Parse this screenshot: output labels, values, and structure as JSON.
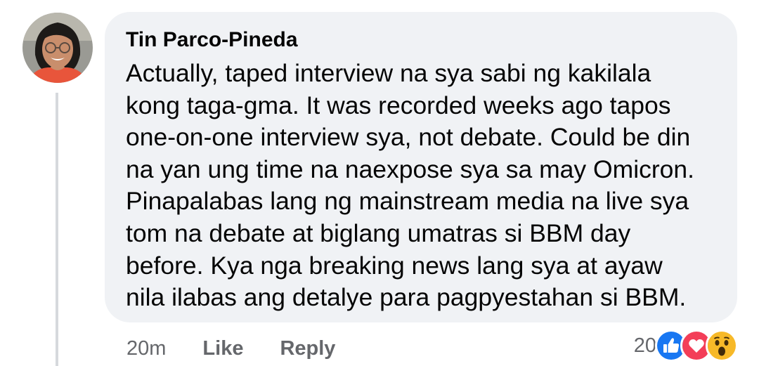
{
  "comment": {
    "author": "Tin Parco-Pineda",
    "text": "Actually, taped interview na sya sabi ng kakilala\nkong taga-gma. It was recorded weeks ago tapos\none-on-one interview sya, not debate. Could be din\nna yan ung time na naexpose sya sa may Omicron.\nPinapalabas lang ng mainstream media na live sya\ntom na debate at biglang umatras si BBM day\nbefore. Kya nga breaking news lang sya at ayaw\nnila ilabas ang detalye para pagpyestahan si BBM."
  },
  "actions": {
    "timestamp": "20m",
    "like_label": "Like",
    "reply_label": "Reply"
  },
  "reactions": {
    "count": "20",
    "icons": [
      "like-icon",
      "love-icon",
      "wow-icon"
    ]
  },
  "colors": {
    "bubble_bg": "#f0f2f5",
    "muted_text": "#65676b",
    "like_blue": "#1877f2",
    "love_red": "#f33e58",
    "wow_yellow": "#f7b928"
  }
}
